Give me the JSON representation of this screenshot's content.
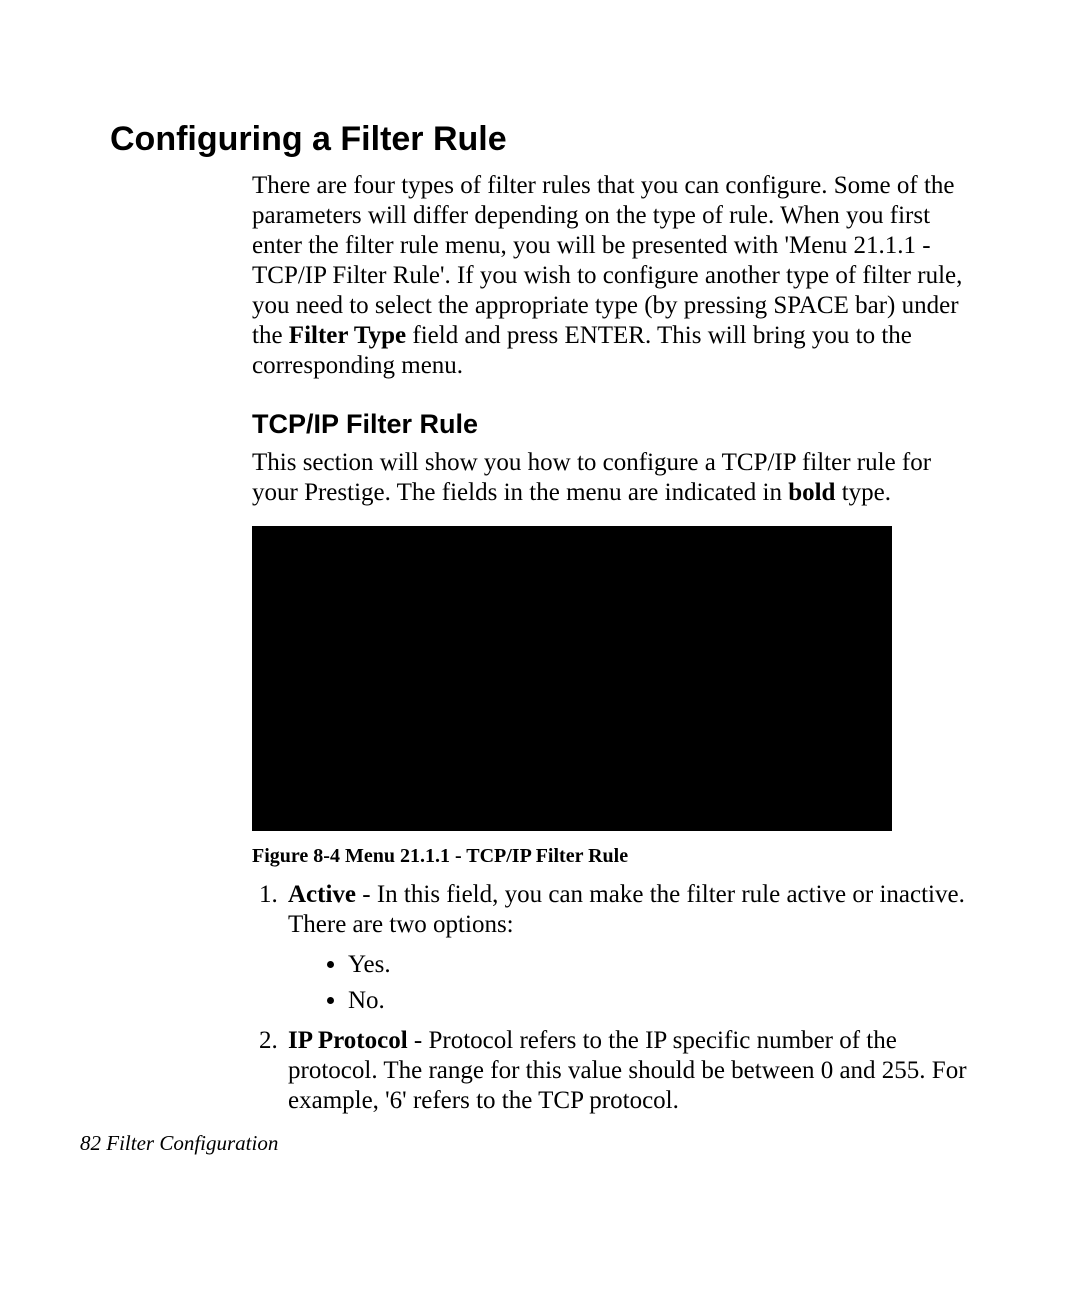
{
  "heading": "Configuring a Filter Rule",
  "intro": {
    "part1": "There are four types of filter rules that you can configure. Some of the parameters will differ depending on the type of rule. When you first enter the filter rule menu, you will be presented with 'Menu 21.1.1 - TCP/IP Filter Rule'. If you wish to configure another type of filter rule, you need to select the appropriate type (by pressing SPACE bar) under the ",
    "bold1": "Filter Type",
    "part2": " field and press ENTER. This will bring you to the corresponding menu."
  },
  "subheading": "TCP/IP Filter Rule",
  "sub_intro": {
    "part1": "This section will show you how to configure a TCP/IP filter rule for your Prestige. The fields in the menu are indicated in ",
    "bold1": "bold",
    "part2": " type."
  },
  "figure_caption": "Figure 8-4 Menu 21.1.1 - TCP/IP Filter Rule",
  "list": {
    "item1": {
      "label": "Active",
      "text": " - In this field, you can make the filter rule active or inactive. There are two options:",
      "opt1": "Yes.",
      "opt2": "No."
    },
    "item2": {
      "label": "IP Protocol",
      "text": " - Protocol refers to the IP specific number of the protocol. The range for this value should be between 0 and 255. For example, '6' refers to the TCP protocol."
    }
  },
  "footer": {
    "page": "82",
    "title": "  Filter Configuration"
  }
}
